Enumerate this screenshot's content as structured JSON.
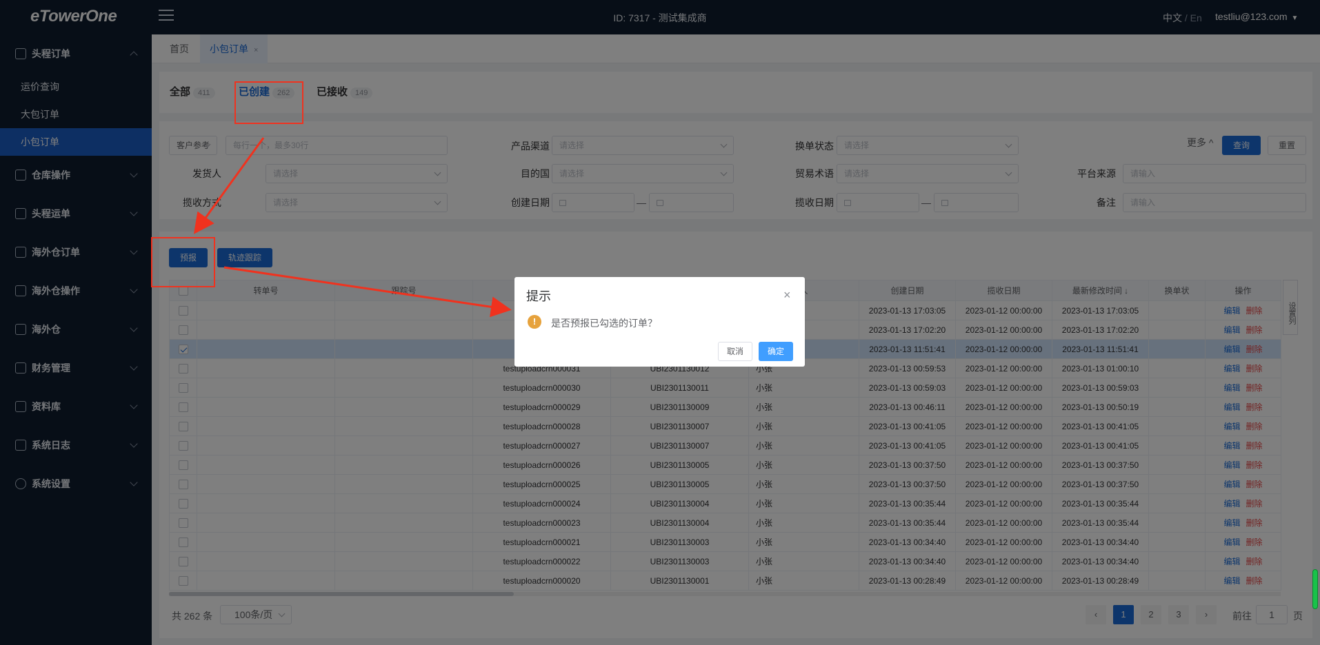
{
  "topbar": {
    "logo": "eTowerOne",
    "center_id": "ID: 7317 - 测试集成商",
    "lang_zh": "中文",
    "lang_sep": "/",
    "lang_en": "En",
    "user": "testliu@123.com"
  },
  "sidebar": {
    "groups": [
      {
        "label": "头程订单",
        "icon": "order-icon",
        "expanded": true
      },
      {
        "label": "仓库操作",
        "icon": "warehouse-ops-icon"
      },
      {
        "label": "头程运单",
        "icon": "lock-icon"
      },
      {
        "label": "海外仓订单",
        "icon": "doc-icon"
      },
      {
        "label": "海外仓操作",
        "icon": "house-icon"
      },
      {
        "label": "海外仓",
        "icon": "building-icon"
      },
      {
        "label": "财务管理",
        "icon": "yen-icon"
      },
      {
        "label": "资料库",
        "icon": "chart-icon"
      },
      {
        "label": "系统日志",
        "icon": "calendar-icon"
      },
      {
        "label": "系统设置",
        "icon": "gear-icon"
      }
    ],
    "sub_items": [
      "运价查询",
      "大包订单",
      "小包订单"
    ],
    "active_sub": "小包订单"
  },
  "tabs": {
    "home": "首页",
    "current": "小包订单",
    "close": "×"
  },
  "status_tabs": [
    {
      "label": "全部",
      "count": "411"
    },
    {
      "label": "已创建",
      "count": "262"
    },
    {
      "label": "已接收",
      "count": "149"
    }
  ],
  "filters": {
    "customer_select": "客户参考",
    "customer_placeholder": "每行一个，最多30行",
    "product_channel": "产品渠道",
    "exchange_status": "换单状态",
    "shipper": "发货人",
    "dest_country": "目的国",
    "trade_terms": "贸易术语",
    "platform_source": "平台来源",
    "pickup_method": "揽收方式",
    "created_date": "创建日期",
    "pickup_date": "揽收日期",
    "remark": "备注",
    "select_placeholder": "请选择",
    "input_placeholder": "请输入",
    "dash": "—",
    "more": "更多",
    "query": "查询",
    "reset": "重置"
  },
  "actions": {
    "predeclare": "预报",
    "tracking": "轨迹跟踪"
  },
  "table": {
    "headers": [
      "转单号",
      "跟踪号",
      "",
      "",
      "人",
      "创建日期",
      "揽收日期",
      "最新修改时间",
      "换单状",
      "操作"
    ],
    "edit": "编辑",
    "delete": "删除",
    "rows": [
      {
        "ref": "test",
        "no": "",
        "who": "",
        "created": "2023-01-13 17:03:05",
        "pickup": "2023-01-12 00:00:00",
        "modified": "2023-01-13 17:03:05",
        "checked": false
      },
      {
        "ref": "test",
        "no": "",
        "who": "",
        "created": "2023-01-13 17:02:20",
        "pickup": "2023-01-12 00:00:00",
        "modified": "2023-01-13 17:02:20",
        "checked": false
      },
      {
        "ref": "test",
        "no": "",
        "who": "",
        "created": "2023-01-13 11:51:41",
        "pickup": "2023-01-12 00:00:00",
        "modified": "2023-01-13 11:51:41",
        "checked": true
      },
      {
        "ref": "testuploadcrn000031",
        "no": "UBI2301130012",
        "who": "小张",
        "created": "2023-01-13 00:59:53",
        "pickup": "2023-01-12 00:00:00",
        "modified": "2023-01-13 01:00:10",
        "checked": false
      },
      {
        "ref": "testuploadcrn000030",
        "no": "UBI2301130011",
        "who": "小张",
        "created": "2023-01-13 00:59:03",
        "pickup": "2023-01-12 00:00:00",
        "modified": "2023-01-13 00:59:03",
        "checked": false
      },
      {
        "ref": "testuploadcrn000029",
        "no": "UBI2301130009",
        "who": "小张",
        "created": "2023-01-13 00:46:11",
        "pickup": "2023-01-12 00:00:00",
        "modified": "2023-01-13 00:50:19",
        "checked": false
      },
      {
        "ref": "testuploadcrn000028",
        "no": "UBI2301130007",
        "who": "小张",
        "created": "2023-01-13 00:41:05",
        "pickup": "2023-01-12 00:00:00",
        "modified": "2023-01-13 00:41:05",
        "checked": false
      },
      {
        "ref": "testuploadcrn000027",
        "no": "UBI2301130007",
        "who": "小张",
        "created": "2023-01-13 00:41:05",
        "pickup": "2023-01-12 00:00:00",
        "modified": "2023-01-13 00:41:05",
        "checked": false
      },
      {
        "ref": "testuploadcrn000026",
        "no": "UBI2301130005",
        "who": "小张",
        "created": "2023-01-13 00:37:50",
        "pickup": "2023-01-12 00:00:00",
        "modified": "2023-01-13 00:37:50",
        "checked": false
      },
      {
        "ref": "testuploadcrn000025",
        "no": "UBI2301130005",
        "who": "小张",
        "created": "2023-01-13 00:37:50",
        "pickup": "2023-01-12 00:00:00",
        "modified": "2023-01-13 00:37:50",
        "checked": false
      },
      {
        "ref": "testuploadcrn000024",
        "no": "UBI2301130004",
        "who": "小张",
        "created": "2023-01-13 00:35:44",
        "pickup": "2023-01-12 00:00:00",
        "modified": "2023-01-13 00:35:44",
        "checked": false
      },
      {
        "ref": "testuploadcrn000023",
        "no": "UBI2301130004",
        "who": "小张",
        "created": "2023-01-13 00:35:44",
        "pickup": "2023-01-12 00:00:00",
        "modified": "2023-01-13 00:35:44",
        "checked": false
      },
      {
        "ref": "testuploadcrn000021",
        "no": "UBI2301130003",
        "who": "小张",
        "created": "2023-01-13 00:34:40",
        "pickup": "2023-01-12 00:00:00",
        "modified": "2023-01-13 00:34:40",
        "checked": false
      },
      {
        "ref": "testuploadcrn000022",
        "no": "UBI2301130003",
        "who": "小张",
        "created": "2023-01-13 00:34:40",
        "pickup": "2023-01-12 00:00:00",
        "modified": "2023-01-13 00:34:40",
        "checked": false
      },
      {
        "ref": "testuploadcrn000020",
        "no": "UBI2301130001",
        "who": "小张",
        "created": "2023-01-13 00:28:49",
        "pickup": "2023-01-12 00:00:00",
        "modified": "2023-01-13 00:28:49",
        "checked": false
      }
    ],
    "side_config": "设置列"
  },
  "pagination": {
    "total": "共 262 条",
    "page_size": "100条/页",
    "pages": [
      "1",
      "2",
      "3"
    ],
    "prev": "‹",
    "next": "›",
    "goto_prefix": "前往",
    "goto_value": "1",
    "goto_suffix": "页"
  },
  "dialog": {
    "title": "提示",
    "message": "是否预报已勾选的订单？",
    "cancel": "取消",
    "confirm": "确定",
    "close": "×",
    "warn": "!"
  },
  "colors": {
    "primary": "#1a6bd6",
    "sidebar_bg": "#0e1c2f",
    "annotation": "#f0321e",
    "danger": "#e54545"
  }
}
